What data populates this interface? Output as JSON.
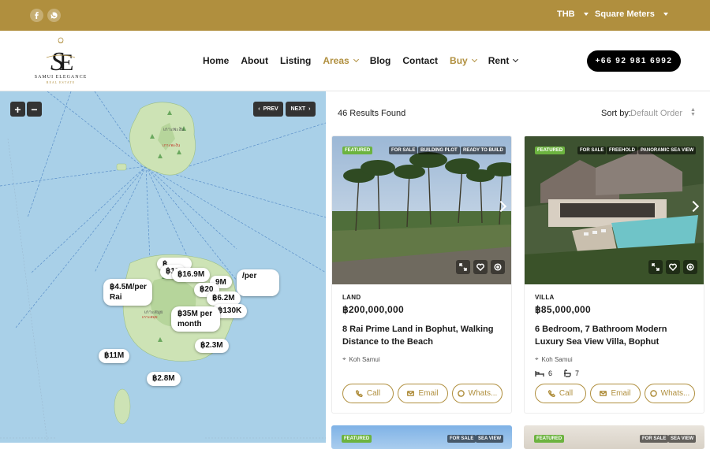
{
  "topbar": {
    "currency": "THB",
    "unit": "Square Meters",
    "social": [
      "facebook-icon",
      "whatsapp-icon"
    ],
    "bg_color": "#b08f3e"
  },
  "header": {
    "logo_tagline": "SAMUI ELEGANCE",
    "logo_subline": "REAL ESTATE",
    "nav": [
      {
        "label": "Home"
      },
      {
        "label": "About"
      },
      {
        "label": "Listing"
      },
      {
        "label": "Areas"
      },
      {
        "label": "Blog"
      },
      {
        "label": "Contact"
      },
      {
        "label": "Buy"
      },
      {
        "label": "Rent"
      }
    ],
    "phone": "+66 92 981 6992"
  },
  "map": {
    "zoom_in": "+",
    "zoom_out": "−",
    "prev": "PREV",
    "next": "NEXT",
    "pins": [
      "฿4.5M/per Rai",
      "฿16.9M",
      "฿130K",
      "฿35M per month",
      "฿6.2M",
      "฿2.3M",
      "฿11M",
      "฿2.8M",
      "฿20",
      "/per",
      "฿13",
      "฿",
      "9M"
    ]
  },
  "results": {
    "count_text": "46 Results Found",
    "sort_label": "Sort by:",
    "sort_value": "Default Order"
  },
  "listings": [
    {
      "tags": [
        "FEATURED",
        "FOR SALE",
        "BUILDING PLOT",
        "READY TO BUILD"
      ],
      "type": "LAND",
      "price": "฿200,000,000",
      "title": "8 Rai Prime Land in Bophut, Walking Distance to the Beach",
      "location": "Koh Samui",
      "actions": [
        "Call",
        "Email",
        "Whats..."
      ]
    },
    {
      "tags": [
        "FEATURED",
        "FOR SALE",
        "FREEHOLD",
        "PANORAMIC SEA VIEW"
      ],
      "type": "VILLA",
      "price": "฿85,000,000",
      "title": "6 Bedroom, 7 Bathroom Modern Luxury Sea View Villa, Bophut",
      "location": "Koh Samui",
      "beds": "6",
      "baths": "7",
      "actions": [
        "Call",
        "Email",
        "Whats..."
      ]
    }
  ],
  "next_row": [
    {
      "tags": [
        "FEATURED",
        "FOR SALE",
        "SEA VIEW"
      ]
    },
    {
      "tags": [
        "FEATURED",
        "FOR SALE",
        "SEA VIEW"
      ]
    }
  ]
}
